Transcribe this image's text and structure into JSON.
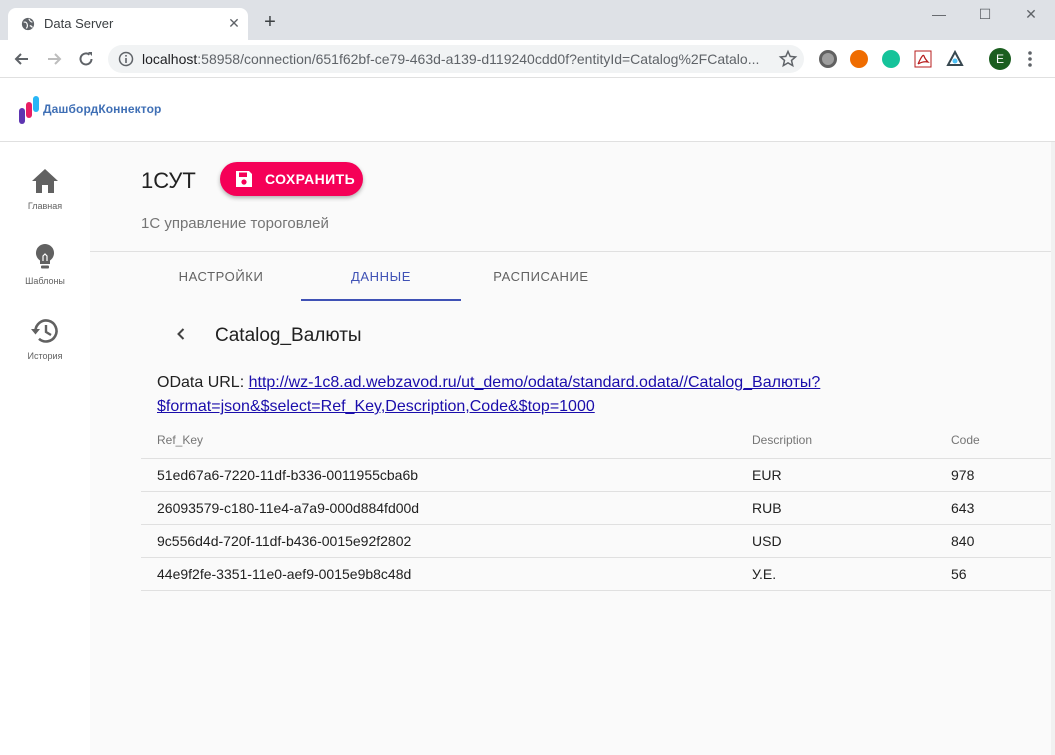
{
  "browser": {
    "tab_title": "Data Server",
    "tab_close": "✕",
    "new_tab": "+",
    "window_minimize": "—",
    "window_maximize": "☐",
    "window_close": "✕",
    "url_host": "localhost",
    "url_rest": ":58958/connection/651f62bf-ce79-463d-a139-d119240cdd0f?entityId=Catalog%2FCatalo...",
    "profile_initial": "E"
  },
  "app": {
    "logo_text": "ДашбордКоннектор"
  },
  "sidebar": {
    "items": [
      {
        "label": "Главная",
        "icon": "home-icon"
      },
      {
        "label": "Шаблоны",
        "icon": "lightbulb-icon"
      },
      {
        "label": "История",
        "icon": "history-icon"
      }
    ]
  },
  "header": {
    "title": "1СУТ",
    "save_label": "СОХРАНИТЬ",
    "subtitle": "1С управление тороговлей"
  },
  "tabs": [
    {
      "label": "НАСТРОЙКИ",
      "active": false
    },
    {
      "label": "ДАННЫЕ",
      "active": true
    },
    {
      "label": "РАСПИСАНИЕ",
      "active": false
    }
  ],
  "entity": {
    "title": "Catalog_Валюты",
    "odata_prefix": "OData URL: ",
    "odata_url_line1": "http://wz-1c8.ad.webzavod.ru/ut_demo/odata/standard.odata//Catalog_Валюты?",
    "odata_url_line2": "$format=json&$select=Ref_Key,Description,Code&$top=1000"
  },
  "table": {
    "columns": [
      "Ref_Key",
      "Description",
      "Code"
    ],
    "rows": [
      [
        "51ed67a6-7220-11df-b336-0011955cba6b",
        "EUR",
        "978"
      ],
      [
        "26093579-c180-11e4-a7a9-000d884fd00d",
        "RUB",
        "643"
      ],
      [
        "9c556d4d-720f-11df-b436-0015e92f2802",
        "USD",
        "840"
      ],
      [
        "44e9f2fe-3351-11e0-aef9-0015e9b8c48d",
        "У.Е.",
        "56"
      ]
    ]
  },
  "colors": {
    "accent": "#f50057",
    "primary": "#3f51b5",
    "logo": "#3f6fb5"
  }
}
